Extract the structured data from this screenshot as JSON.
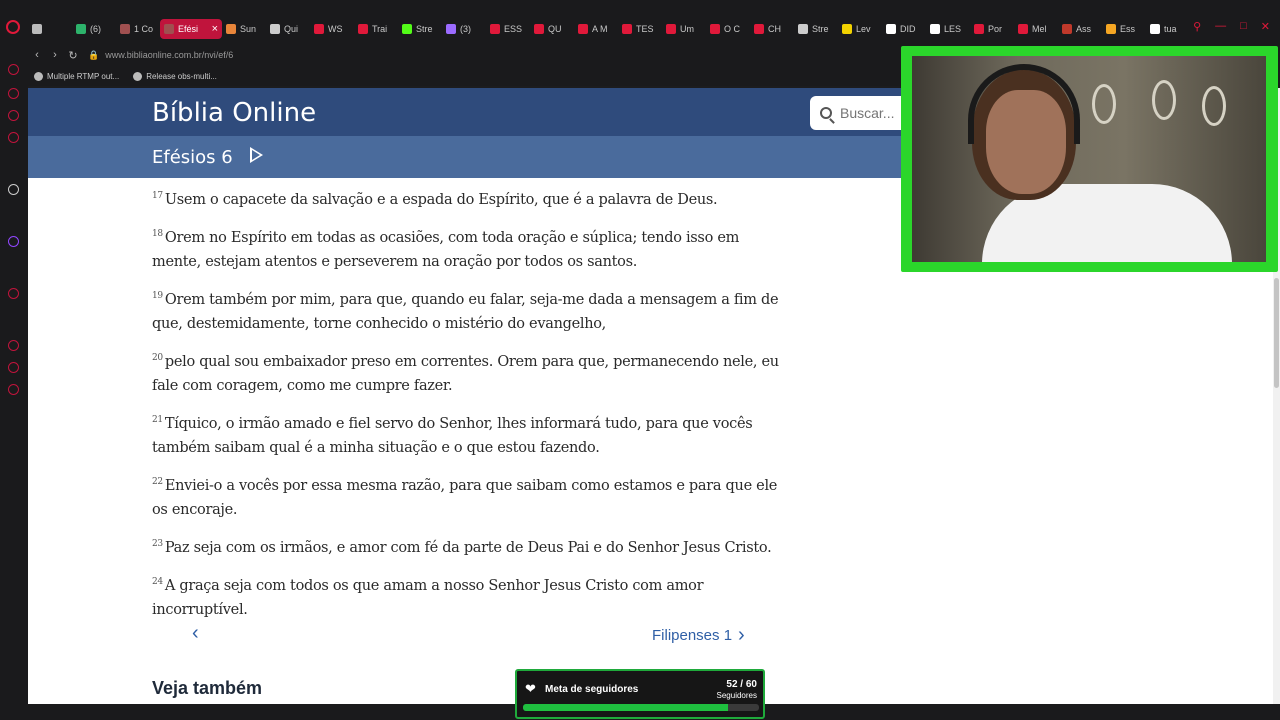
{
  "browser": {
    "tabs": [
      {
        "label": "",
        "icon": "inbox-icon",
        "color": "#bbbbbb"
      },
      {
        "label": "(6)",
        "icon": "green-icon",
        "color": "#2db36b"
      },
      {
        "label": "1 Co",
        "icon": "bible-icon",
        "color": "#a05050"
      },
      {
        "label": "Efési",
        "icon": "bible-icon",
        "color": "#a05050",
        "active": true
      },
      {
        "label": "Sun",
        "icon": "orange-icon",
        "color": "#e8853a"
      },
      {
        "label": "Qui",
        "icon": "t-icon",
        "color": "#cccccc"
      },
      {
        "label": "WS",
        "icon": "youtube-icon",
        "color": "#e0193a"
      },
      {
        "label": "Trai",
        "icon": "youtube-icon",
        "color": "#e0193a"
      },
      {
        "label": "Stre",
        "icon": "kick-icon",
        "color": "#53fc18"
      },
      {
        "label": "(3)",
        "icon": "chat-icon",
        "color": "#9b6bff"
      },
      {
        "label": "ESS",
        "icon": "youtube-icon",
        "color": "#e0193a"
      },
      {
        "label": "QU",
        "icon": "youtube-icon",
        "color": "#e0193a"
      },
      {
        "label": "A M",
        "icon": "youtube-icon",
        "color": "#e0193a"
      },
      {
        "label": "TES",
        "icon": "youtube-icon",
        "color": "#e0193a"
      },
      {
        "label": "Um",
        "icon": "youtube-icon",
        "color": "#e0193a"
      },
      {
        "label": "O C",
        "icon": "youtube-icon",
        "color": "#e0193a"
      },
      {
        "label": "CH",
        "icon": "youtube-icon",
        "color": "#e0193a"
      },
      {
        "label": "Stre",
        "icon": "wheel-icon",
        "color": "#cccccc"
      },
      {
        "label": "Lev",
        "icon": "yellow-icon",
        "color": "#f2d200"
      },
      {
        "label": "DID",
        "icon": "doc-icon",
        "color": "#ffffff"
      },
      {
        "label": "LES",
        "icon": "doc-icon",
        "color": "#ffffff"
      },
      {
        "label": "Por",
        "icon": "youtube-icon",
        "color": "#e0193a"
      },
      {
        "label": "Mel",
        "icon": "youtube-icon",
        "color": "#e0193a"
      },
      {
        "label": "Ass",
        "icon": "red-icon",
        "color": "#c0392b"
      },
      {
        "label": "Ess",
        "icon": "shield-icon",
        "color": "#f5a623"
      },
      {
        "label": "tua",
        "icon": "google-icon",
        "color": "#ffffff"
      }
    ],
    "url": "www.bibliaonline.com.br/nvi/ef/6",
    "bookmarks": [
      "Multiple RTMP out...",
      "Release obs-multi..."
    ]
  },
  "site": {
    "title": "Bíblia Online",
    "search_placeholder": "Buscar...",
    "chapter": "Efésios 6"
  },
  "verses": [
    {
      "num": "17",
      "text": "Usem o capacete da salvação e a espada do Espírito, que é a palavra de Deus."
    },
    {
      "num": "18",
      "text": "Orem no Espírito em todas as ocasiões, com toda oração e súplica; tendo isso em mente, estejam atentos e perseverem na oração por todos os santos."
    },
    {
      "num": "19",
      "text": "Orem também por mim, para que, quando eu falar, seja-me dada a mensagem a fim de que, destemidamente, torne conhecido o mistério do evangelho,"
    },
    {
      "num": "20",
      "text": "pelo qual sou embaixador preso em correntes. Orem para que, permanecendo nele, eu fale com coragem, como me cumpre fazer."
    },
    {
      "num": "21",
      "text": "Tíquico, o irmão amado e fiel servo do Senhor, lhes informará tudo, para que vocês também saibam qual é a minha situação e o que estou fazendo."
    },
    {
      "num": "22",
      "text": "Enviei-o a vocês por essa mesma razão, para que saibam como estamos e para que ele os encoraje."
    },
    {
      "num": "23",
      "text": "Paz seja com os irmãos, e amor com fé da parte de Deus Pai e do Senhor Jesus Cristo."
    },
    {
      "num": "24",
      "text": "A graça seja com todos os que amam a nosso Senhor Jesus Cristo com amor incorruptível."
    }
  ],
  "nav": {
    "next_label": "Filipenses 1"
  },
  "see_also": "Veja também",
  "goal": {
    "title": "Meta de seguidores",
    "count": "52 / 60",
    "unit": "Seguidores",
    "progress": 0.8667
  }
}
